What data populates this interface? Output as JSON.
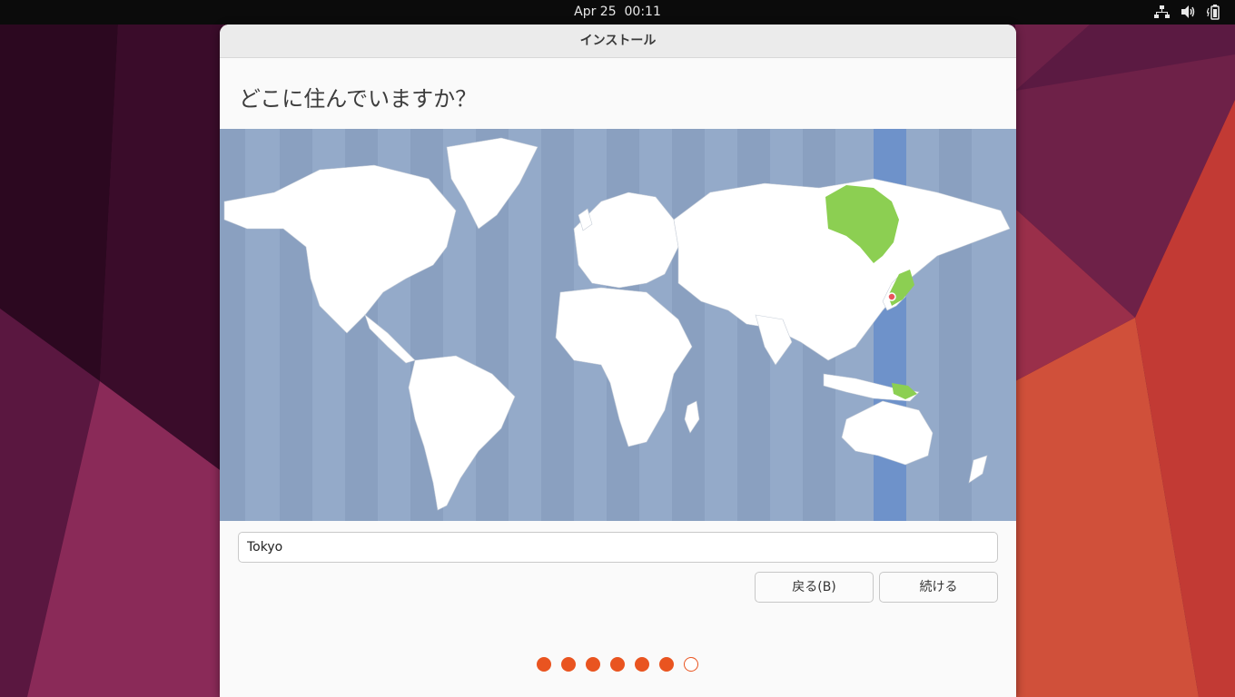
{
  "topbar": {
    "clock": "Apr 25  00:11",
    "tray_icons": [
      "network-icon",
      "volume-icon",
      "battery-icon"
    ]
  },
  "window": {
    "title": "インストール",
    "heading": "どこに住んでいますか？"
  },
  "map": {
    "ocean_color": "#94aac9",
    "land_color": "#ffffff",
    "selected_region_color": "#8ccf52",
    "timezone_highlight_color": "#6e92ca",
    "selected_city": "Tokyo"
  },
  "location": {
    "value": "Tokyo"
  },
  "buttons": {
    "back": "戻る(B)",
    "continue": "続ける"
  },
  "progress": {
    "total_steps": 7,
    "completed_steps": 6,
    "accent_color": "#e95420"
  }
}
